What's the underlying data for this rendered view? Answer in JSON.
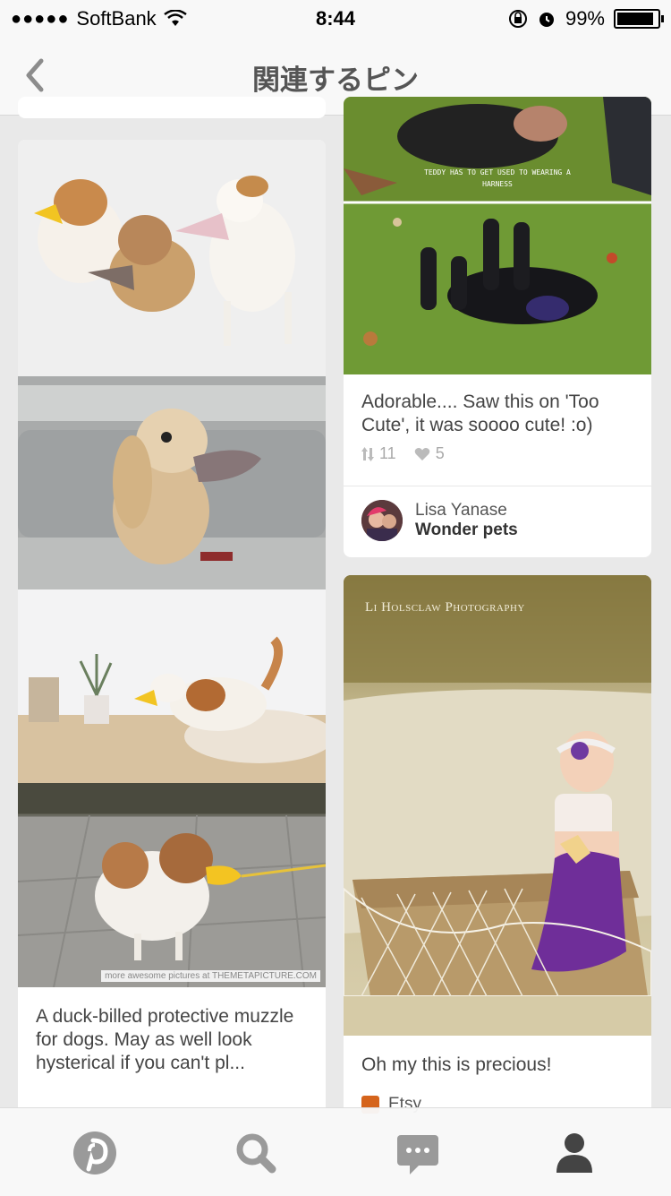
{
  "status_bar": {
    "carrier": "SoftBank",
    "time": "8:44",
    "battery": "99%",
    "battery_level": 0.99
  },
  "nav": {
    "title": "関連するピン",
    "back_icon": "chevron-left-icon"
  },
  "pins": {
    "left": {
      "photo_watermark": "more awesome pictures at THEMETAPICTURE.COM",
      "caption": "A duck-billed protective muzzle for dogs. May as well look hysterical if you can't pl..."
    },
    "right_top": {
      "photo_text": "TEDDY HAS TO GET USED TO WEARING A HARNESS",
      "caption": "Adorable.... Saw this on 'Too Cute', it was soooo cute! :o)",
      "repins": "11",
      "likes": "5",
      "pinner_name": "Lisa Yanase",
      "board_name": "Wonder pets"
    },
    "right_bottom": {
      "photo_watermark": "Li Holsclaw Photography",
      "caption": "Oh my this is precious!",
      "source": "Etsy"
    }
  },
  "tabbar": {
    "items": [
      "pinterest-icon",
      "search-icon",
      "chat-icon",
      "profile-icon"
    ]
  },
  "colors": {
    "background": "#e9e9e9",
    "pinterest_red": "#cb2027",
    "tab_icon": "#9a9a9a",
    "tab_active": "#444444"
  }
}
